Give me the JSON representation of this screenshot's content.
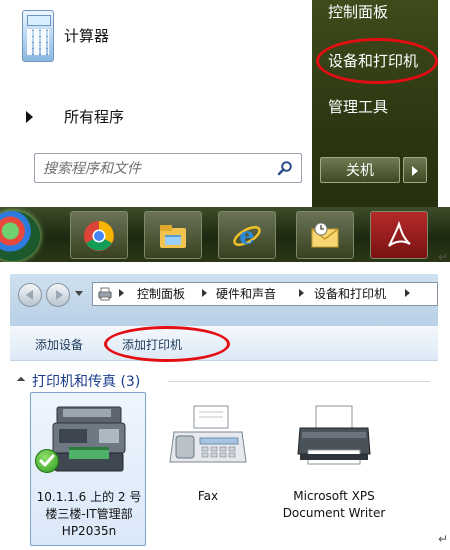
{
  "start_menu": {
    "programs": [
      {
        "label": "计算器"
      }
    ],
    "all_programs_label": "所有程序",
    "search_placeholder": "搜索程序和文件",
    "right_pane": {
      "control_panel": "控制面板",
      "devices_printers": "设备和打印机",
      "admin_tools": "管理工具",
      "shutdown_label": "关机"
    }
  },
  "taskbar": {
    "pinned": [
      "chrome-icon",
      "windows-explorer-icon",
      "internet-explorer-icon",
      "outlook-icon",
      "pdf-reader-icon"
    ]
  },
  "explorer": {
    "breadcrumb": [
      "控制面板",
      "硬件和声音",
      "设备和打印机"
    ],
    "commands": {
      "add_device": "添加设备",
      "add_printer": "添加打印机"
    },
    "group": {
      "title": "打印机和传真 (3)"
    },
    "devices": [
      {
        "label": "10.1.1.6 上的 2 号楼三楼-IT管理部HP2035n",
        "default": true
      },
      {
        "label": "Fax"
      },
      {
        "label": "Microsoft XPS Document Writer"
      }
    ]
  },
  "highlight_color": "#e30d12",
  "return_mark": "↵"
}
